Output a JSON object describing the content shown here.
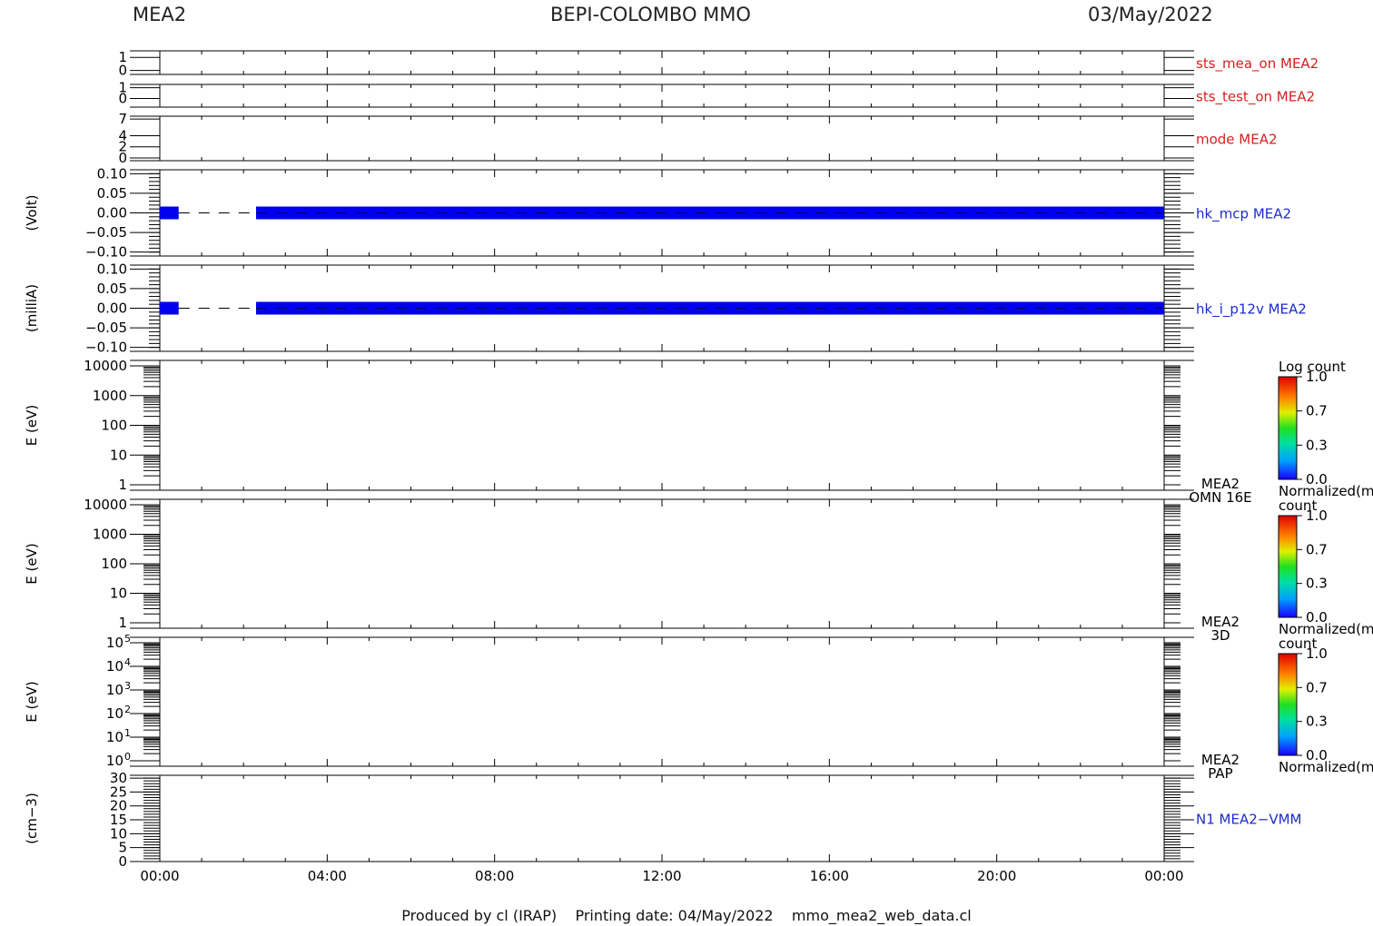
{
  "header": {
    "left": "MEA2",
    "center": "BEPI-COLOMBO MMO",
    "right": "03/May/2022"
  },
  "footer": "Produced by cl (IRAP)    Printing date: 04/May/2022    mmo_mea2_web_data.cl",
  "colors": {
    "red_label": "#d62020",
    "blue_label": "#1c2ccc",
    "data_blue": "#0000ee",
    "axis": "#000000"
  },
  "chart_data": {
    "type": "line",
    "x_axis": {
      "ticks": [
        "00:00",
        "04:00",
        "08:00",
        "12:00",
        "16:00",
        "20:00",
        "00:00"
      ],
      "range_hours": [
        0,
        24
      ]
    },
    "panels": [
      {
        "label": "sts_mea_on MEA2",
        "label_color": "#d62020",
        "ytick_labels": [
          "1",
          "0"
        ],
        "yticks": [
          1,
          0
        ],
        "ylim": [
          -0.3,
          1.5
        ],
        "ylabel": ""
      },
      {
        "label": "sts_test_on MEA2",
        "label_color": "#d62020",
        "ytick_labels": [
          "1",
          "0"
        ],
        "yticks": [
          1,
          0
        ],
        "ylim": [
          -0.8,
          1.3
        ],
        "ylabel": ""
      },
      {
        "label": "mode MEA2",
        "label_color": "#d62020",
        "ytick_labels": [
          "7",
          "4",
          "2",
          "0"
        ],
        "yticks": [
          7,
          4,
          2,
          0
        ],
        "ylim": [
          -0.5,
          7.5
        ],
        "ylabel": ""
      },
      {
        "label": "hk_mcp MEA2",
        "label_color": "#1c2ccc",
        "ylabel": "(Volt)",
        "ytick_labels": [
          "0.10",
          "0.05",
          "0.00",
          "−0.05",
          "−0.10"
        ],
        "yticks": [
          0.1,
          0.05,
          0.0,
          -0.05,
          -0.1
        ],
        "ylim": [
          -0.11,
          0.11
        ],
        "series": [
          {
            "segments_hours": [
              [
                0,
                0.45
              ],
              [
                2.3,
                24
              ]
            ],
            "value": 0.0,
            "gap_dashed": true
          }
        ]
      },
      {
        "label": "hk_i_p12v MEA2",
        "label_color": "#1c2ccc",
        "ylabel": "(milliA)",
        "ytick_labels": [
          "0.10",
          "0.05",
          "0.00",
          "−0.05",
          "−0.10"
        ],
        "yticks": [
          0.1,
          0.05,
          0.0,
          -0.05,
          -0.1
        ],
        "ylim": [
          -0.11,
          0.11
        ],
        "series": [
          {
            "segments_hours": [
              [
                0,
                0.45
              ],
              [
                2.3,
                24
              ]
            ],
            "value": 0.0,
            "gap_dashed": true
          }
        ]
      },
      {
        "label_lines": [
          "MEA2",
          "OMN 16E"
        ],
        "label_color": "#000000",
        "ylabel": "E (eV)",
        "ytick_labels": [
          "10000",
          "1000",
          "100",
          "10",
          "1"
        ],
        "log": true,
        "ylim": [
          1,
          10000
        ],
        "colorbar": {
          "title": "Log count",
          "ticks": [
            "1.0",
            "0.7",
            "0.3",
            "0.0"
          ],
          "footer": "Normalized(m"
        }
      },
      {
        "label_lines": [
          "MEA2",
          "3D"
        ],
        "label_color": "#000000",
        "ylabel": "E (eV)",
        "ytick_labels": [
          "10000",
          "1000",
          "100",
          "10",
          "1"
        ],
        "log": true,
        "ylim": [
          1,
          10000
        ],
        "colorbar": {
          "title": "count",
          "ticks": [
            "1.0",
            "0.7",
            "0.3",
            "0.0"
          ],
          "footer": "Normalized(m"
        }
      },
      {
        "label_lines": [
          "MEA2",
          "PAP"
        ],
        "label_color": "#000000",
        "ylabel": "E (eV)",
        "ytick_labels": [
          "10",
          "10",
          "10",
          "10",
          "10",
          "10"
        ],
        "ytick_superscripts": [
          "5",
          "4",
          "3",
          "2",
          "1",
          "0"
        ],
        "log": true,
        "ylim": [
          1,
          100000
        ],
        "colorbar": {
          "title": "count",
          "ticks": [
            "1.0",
            "0.7",
            "0.3",
            "0.0"
          ],
          "footer": "Normalized(m"
        }
      },
      {
        "label": "N1 MEA2−VMM",
        "label_color": "#1c2ccc",
        "ylabel": "(cm−3)",
        "ytick_labels": [
          "30",
          "25",
          "20",
          "15",
          "10",
          "5",
          "0"
        ],
        "yticks": [
          30,
          25,
          20,
          15,
          10,
          5,
          0
        ],
        "ylim": [
          0,
          31
        ]
      }
    ]
  }
}
